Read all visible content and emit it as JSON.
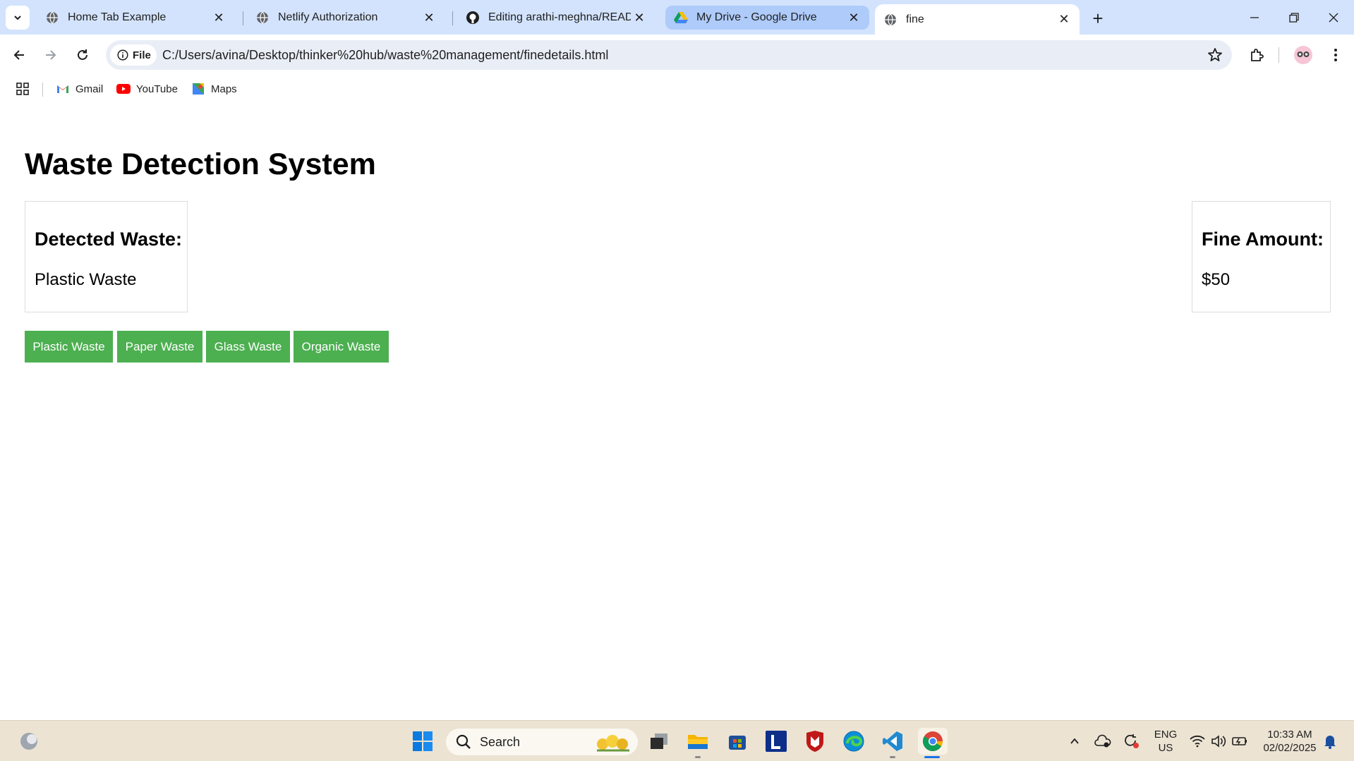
{
  "browser": {
    "tabs": [
      {
        "title": "Home Tab Example"
      },
      {
        "title": "Netlify Authorization"
      },
      {
        "title": "Editing arathi-meghna/README"
      },
      {
        "title": "My Drive - Google Drive"
      },
      {
        "title": "fine"
      }
    ],
    "address_chip": "File",
    "url": "C:/Users/avina/Desktop/thinker%20hub/waste%20management/finedetails.html",
    "bookmarks": [
      {
        "label": "Gmail"
      },
      {
        "label": "YouTube"
      },
      {
        "label": "Maps"
      }
    ]
  },
  "page": {
    "title": "Waste Detection System",
    "detected": {
      "heading": "Detected Waste:",
      "value": "Plastic Waste"
    },
    "fine": {
      "heading": "Fine Amount:",
      "value": "$50"
    },
    "buttons": [
      "Plastic Waste",
      "Paper Waste",
      "Glass Waste",
      "Organic Waste"
    ],
    "button_color": "#4caf50"
  },
  "taskbar": {
    "search_label": "Search",
    "language": "ENG",
    "region": "US",
    "time": "10:33 AM",
    "date": "02/02/2025"
  }
}
